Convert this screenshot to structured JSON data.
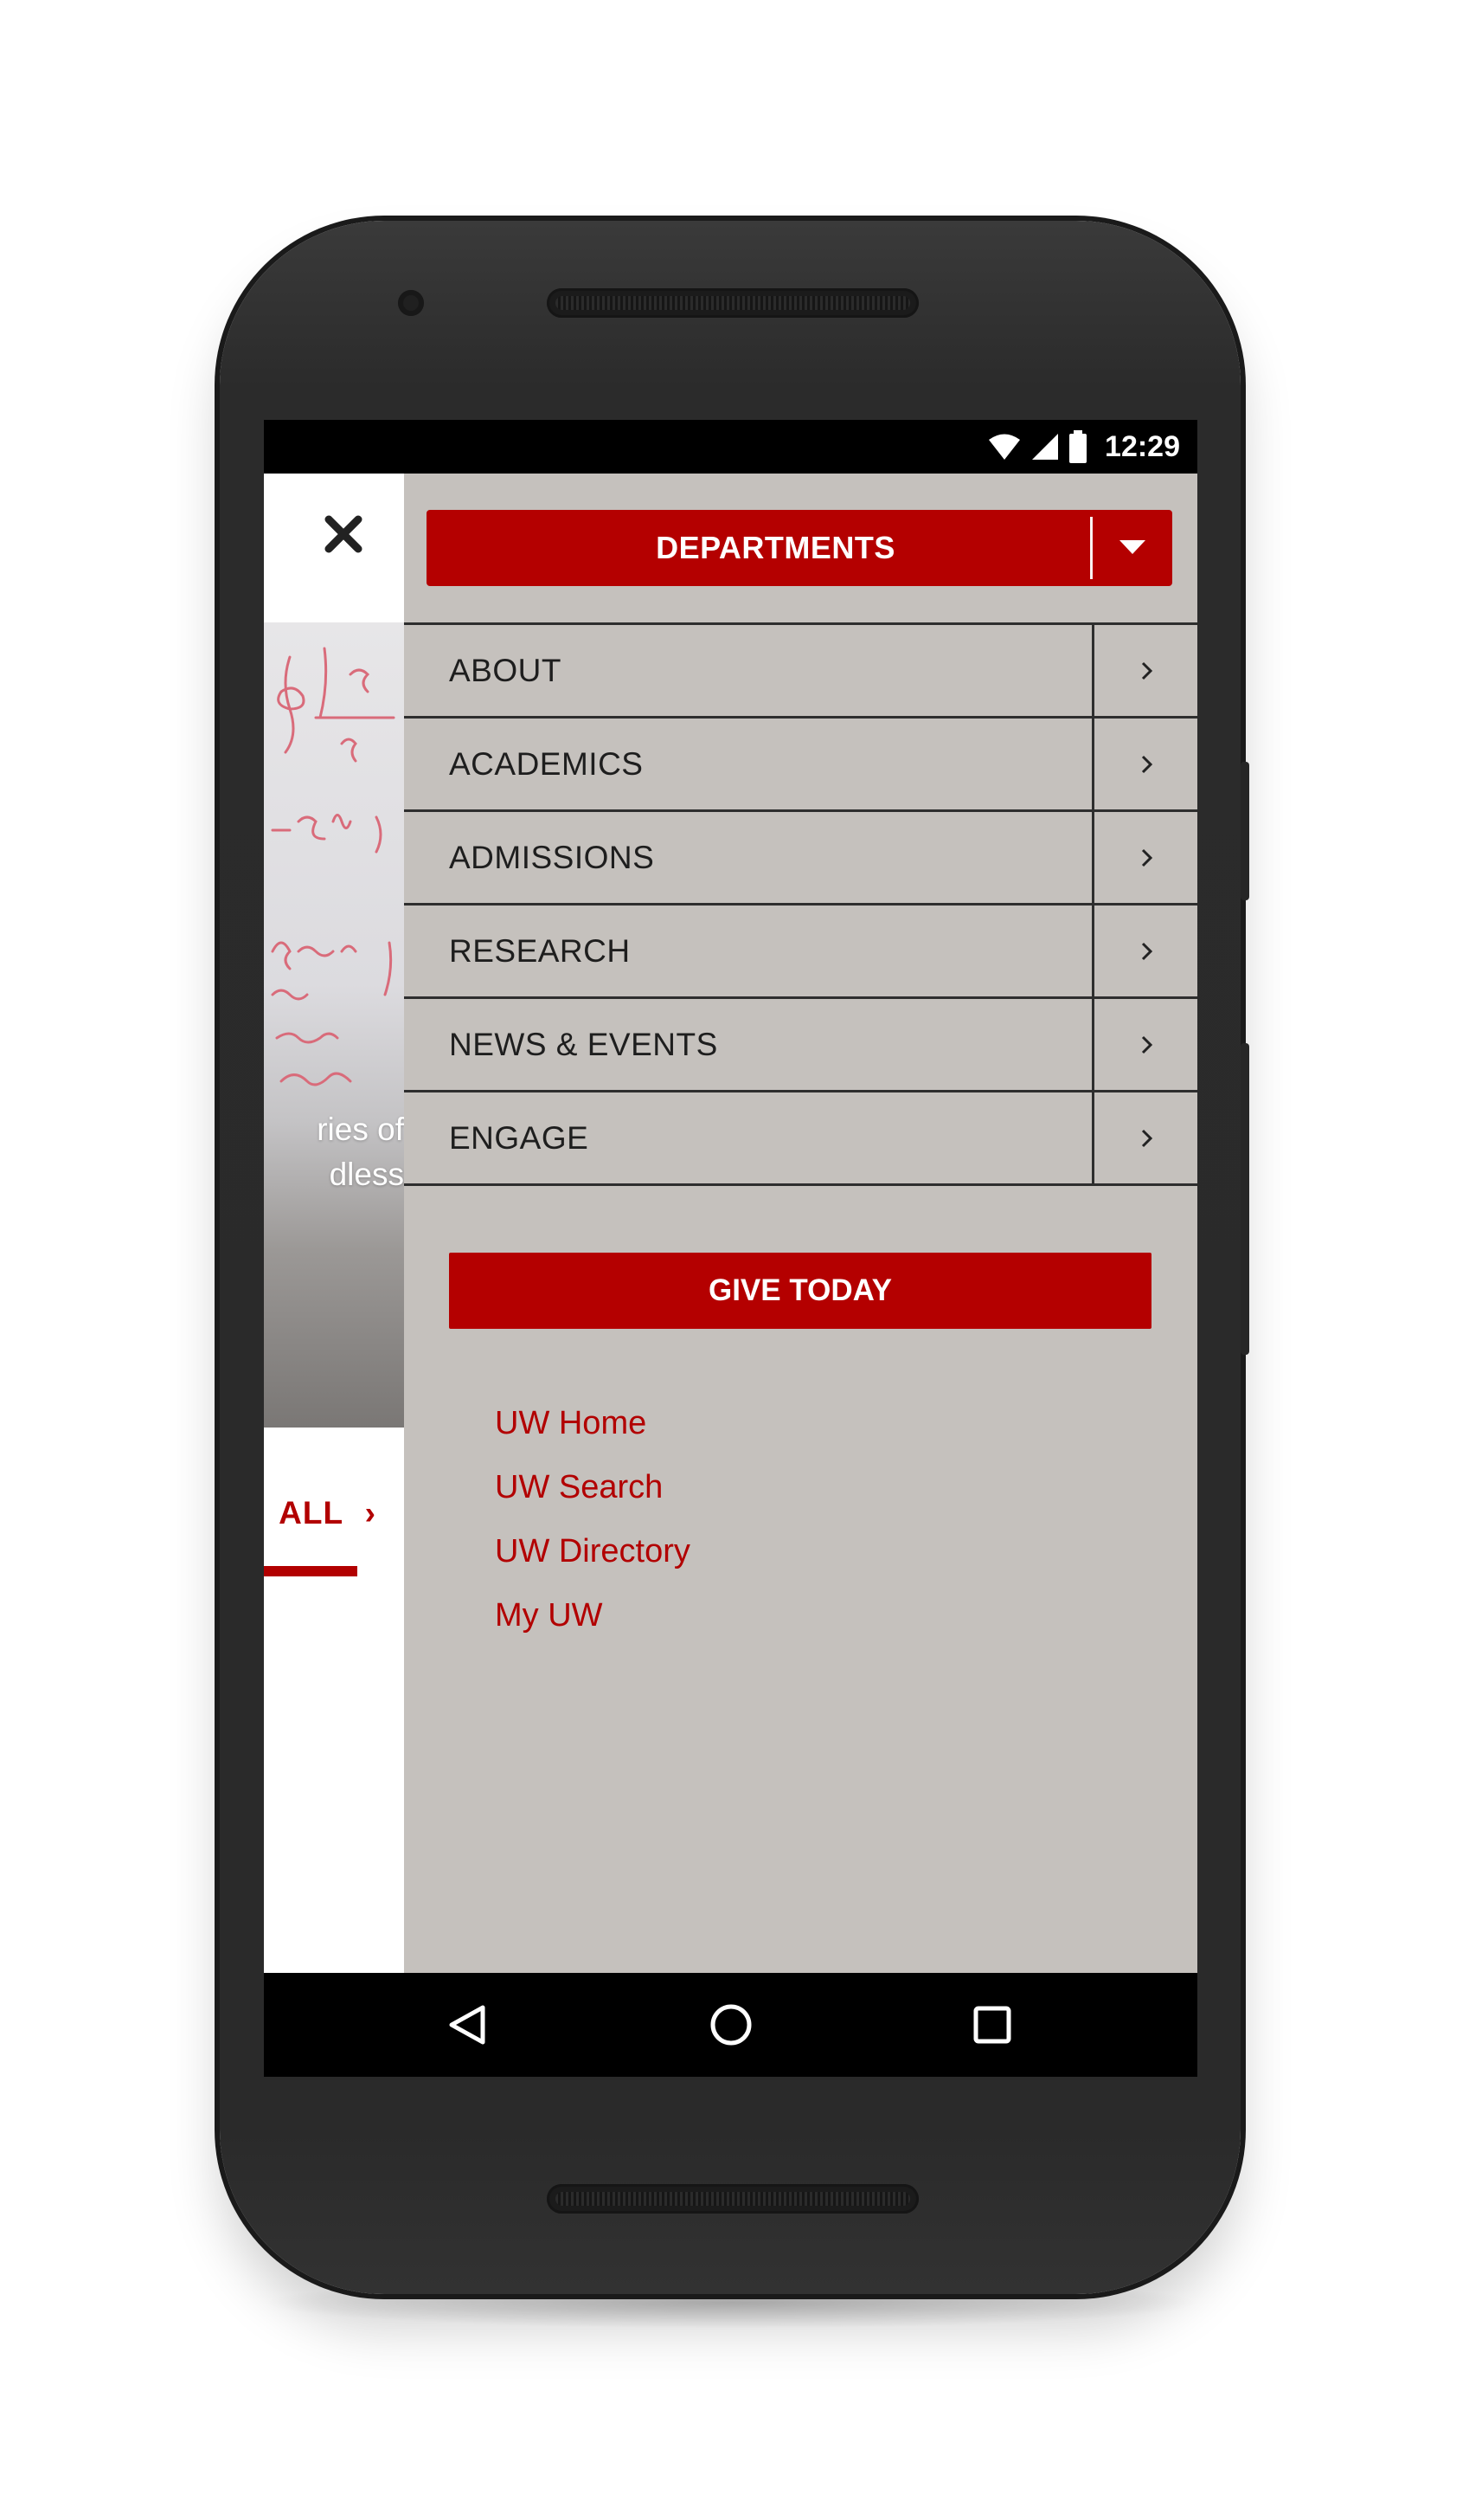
{
  "status_bar": {
    "time": "12:29",
    "icons": [
      "wifi-icon",
      "signal-icon",
      "battery-icon"
    ]
  },
  "page_peek": {
    "hero_text_line1": "ries of",
    "hero_text_line2": "dless",
    "view_all_label": "ALL",
    "view_all_arrow": "›"
  },
  "drawer": {
    "departments_label": "DEPARTMENTS",
    "menu_items": [
      {
        "label": "ABOUT"
      },
      {
        "label": "ACADEMICS"
      },
      {
        "label": "ADMISSIONS"
      },
      {
        "label": "RESEARCH"
      },
      {
        "label": "NEWS & EVENTS"
      },
      {
        "label": "ENGAGE"
      }
    ],
    "give_label": "GIVE TODAY",
    "links": [
      {
        "label": "UW Home"
      },
      {
        "label": "UW Search"
      },
      {
        "label": "UW Directory"
      },
      {
        "label": "My UW"
      }
    ]
  },
  "colors": {
    "brand_red": "#b40000",
    "drawer_bg": "#c5c1bd",
    "text_dark": "#1e1e1e"
  }
}
